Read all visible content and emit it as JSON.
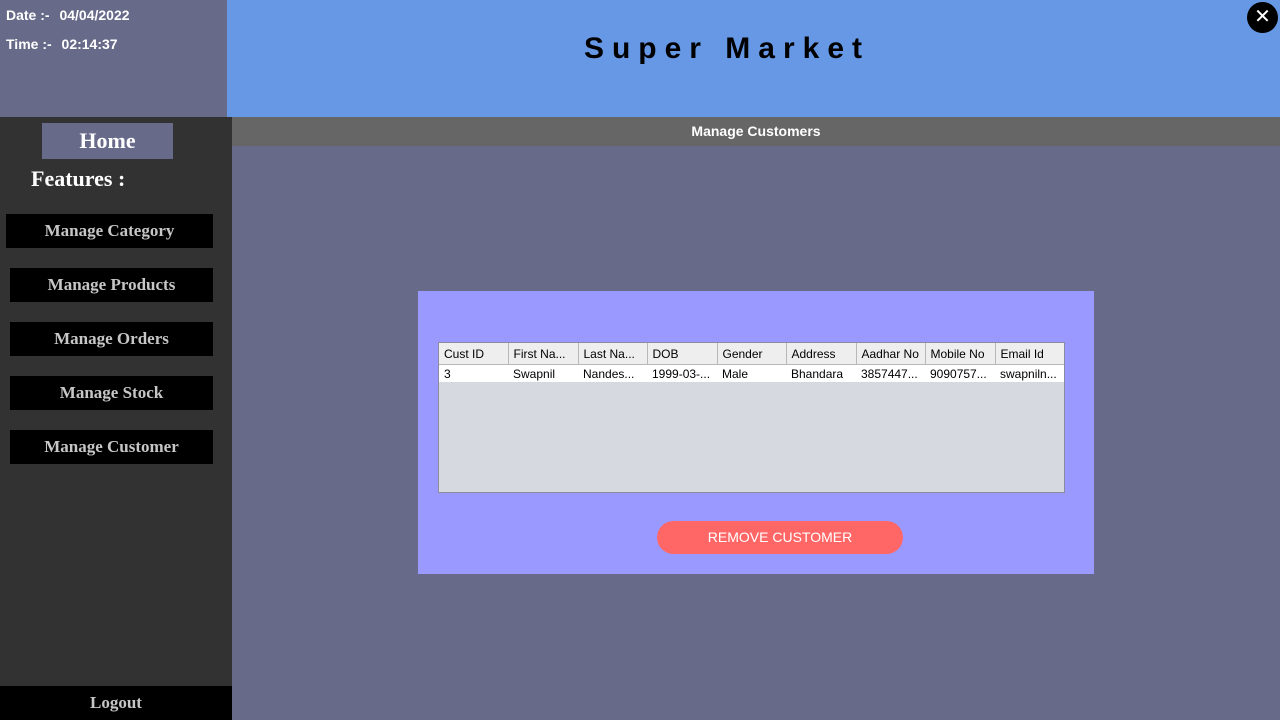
{
  "datetime": {
    "date_label": "Date :-",
    "date_value": "04/04/2022",
    "time_label": "Time :-",
    "time_value": "02:14:37"
  },
  "header": {
    "title": "Super Market",
    "close_icon": "close-icon",
    "close_glyph": "✕"
  },
  "sidebar": {
    "home": "Home",
    "features": "Features :",
    "items": [
      {
        "label": "Manage Category"
      },
      {
        "label": "Manage Products"
      },
      {
        "label": "Manage Orders"
      },
      {
        "label": "Manage Stock"
      },
      {
        "label": "Manage Customer"
      }
    ],
    "logout": "Logout"
  },
  "section": {
    "title": "Manage Customers"
  },
  "table": {
    "columns": [
      "Cust ID",
      "First Na...",
      "Last Na...",
      "DOB",
      "Gender",
      "Address",
      "Aadhar No",
      "Mobile No",
      "Email Id"
    ],
    "rows": [
      [
        "3",
        "Swapnil",
        "Nandes...",
        "1999-03-...",
        "Male",
        "Bhandara",
        "3857447...",
        "9090757...",
        "swapniln..."
      ]
    ]
  },
  "actions": {
    "remove": "REMOVE CUSTOMER"
  },
  "colors": {
    "header_bg": "#6698e6",
    "content_bg": "#676a89",
    "sidebar_bg": "#323232",
    "panel_bg": "#9999ff",
    "remove_button": "#ff6666"
  }
}
